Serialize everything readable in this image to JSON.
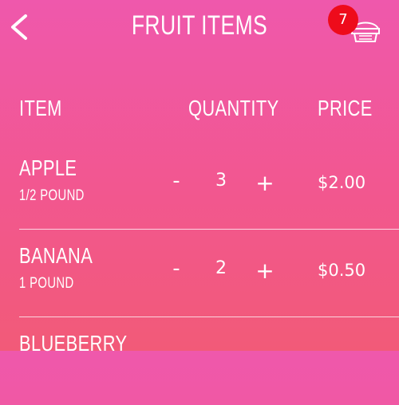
{
  "header": {
    "title": "FRUIT ITEMS",
    "back_icon": "chevron-left-icon",
    "cart_icon": "cart-icon",
    "cart_count": "7"
  },
  "columns": {
    "item": "ITEM",
    "quantity": "QUANTITY",
    "price": "PRICE"
  },
  "items": [
    {
      "name": "APPLE",
      "unit": "1/2 POUND",
      "quantity": "3",
      "price": "$2.00",
      "minus_label": "-",
      "plus_label": "+"
    },
    {
      "name": "BANANA",
      "unit": "1 POUND",
      "quantity": "2",
      "price": "$0.50",
      "minus_label": "-",
      "plus_label": "+"
    },
    {
      "name": "BLUEBERRY"
    }
  ],
  "colors": {
    "background_top": "#ef58ac",
    "background_bottom": "#f25a78",
    "badge": "#ee0b1b",
    "text": "#ffffff"
  }
}
